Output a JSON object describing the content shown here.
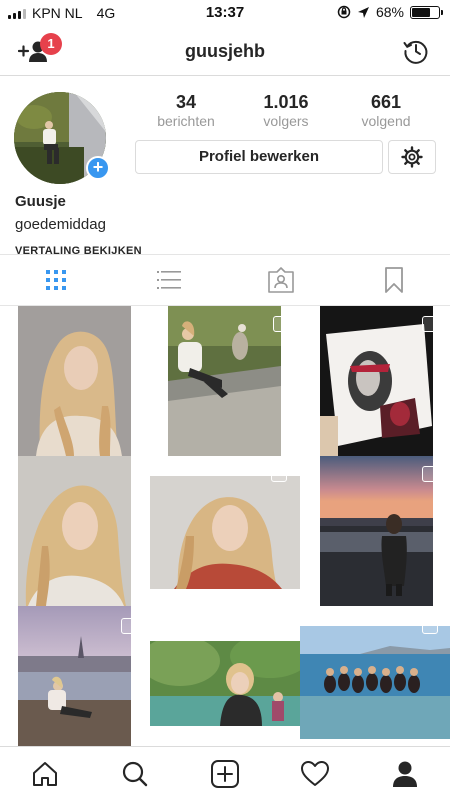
{
  "status_bar": {
    "carrier": "KPN NL",
    "network": "4G",
    "time": "13:37",
    "battery_percent": "68%",
    "battery_level": 0.68
  },
  "header": {
    "username": "guusjehb",
    "notification_count": "1",
    "icons": [
      "add-user-icon",
      "history-icon"
    ]
  },
  "profile": {
    "stats": [
      {
        "value": "34",
        "label": "berichten"
      },
      {
        "value": "1.016",
        "label": "volgers"
      },
      {
        "value": "661",
        "label": "volgend"
      }
    ],
    "edit_button_label": "Profiel bewerken",
    "display_name": "Guusje",
    "bio": "goedemiddag",
    "translate_label": "VERTALING BEKIJKEN"
  },
  "tabs": [
    "grid-icon",
    "list-icon",
    "tagged-icon",
    "bookmark-icon"
  ],
  "active_tab": 0,
  "bottom_nav": [
    "home-icon",
    "search-icon",
    "new-post-icon",
    "activity-icon",
    "profile-icon"
  ],
  "colors": {
    "accent": "#3897f0",
    "badge": "#e6414c",
    "border": "#dbdbdb",
    "secondary_text": "#999999"
  }
}
